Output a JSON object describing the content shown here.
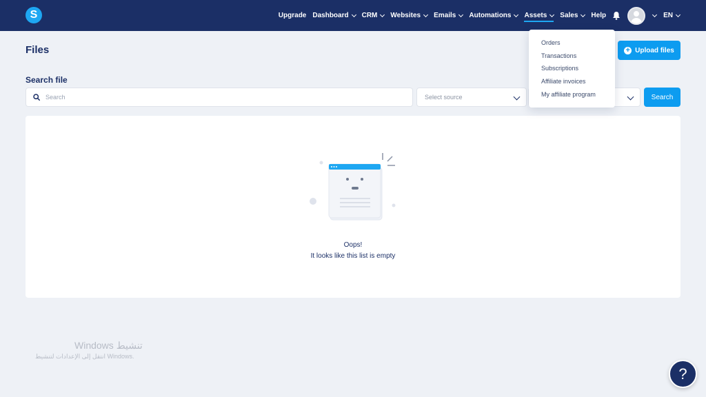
{
  "brand": {
    "logo_letter": "S",
    "accent": "#0d9cf0",
    "nav_bg": "#1b2f66"
  },
  "nav": {
    "items": [
      {
        "label": "Upgrade",
        "dropdown": false
      },
      {
        "label": "Dashboard",
        "dropdown": true
      },
      {
        "label": "CRM",
        "dropdown": true
      },
      {
        "label": "Websites",
        "dropdown": true
      },
      {
        "label": "Emails",
        "dropdown": true
      },
      {
        "label": "Automations",
        "dropdown": true
      },
      {
        "label": "Assets",
        "dropdown": true
      },
      {
        "label": "Sales",
        "dropdown": true
      },
      {
        "label": "Help",
        "dropdown": false
      }
    ],
    "bell_icon": "bell-icon",
    "language": "EN"
  },
  "page": {
    "title": "Files",
    "upload_label": "Upload files"
  },
  "search": {
    "label": "Search file",
    "placeholder": "Search",
    "source_placeholder": "Select source",
    "button_label": "Search"
  },
  "empty_state": {
    "title": "Oops!",
    "subtitle": "It looks like this list is empty"
  },
  "dropdown_menu": {
    "items": [
      "Orders",
      "Transactions",
      "Subscriptions",
      "Affiliate invoices",
      "My affiliate program"
    ]
  },
  "watermark": {
    "title": "Windows تنشيط",
    "subtitle": "انتقل إلى الإعدادات لتنشيط Windows."
  },
  "help": {
    "label": "?"
  }
}
